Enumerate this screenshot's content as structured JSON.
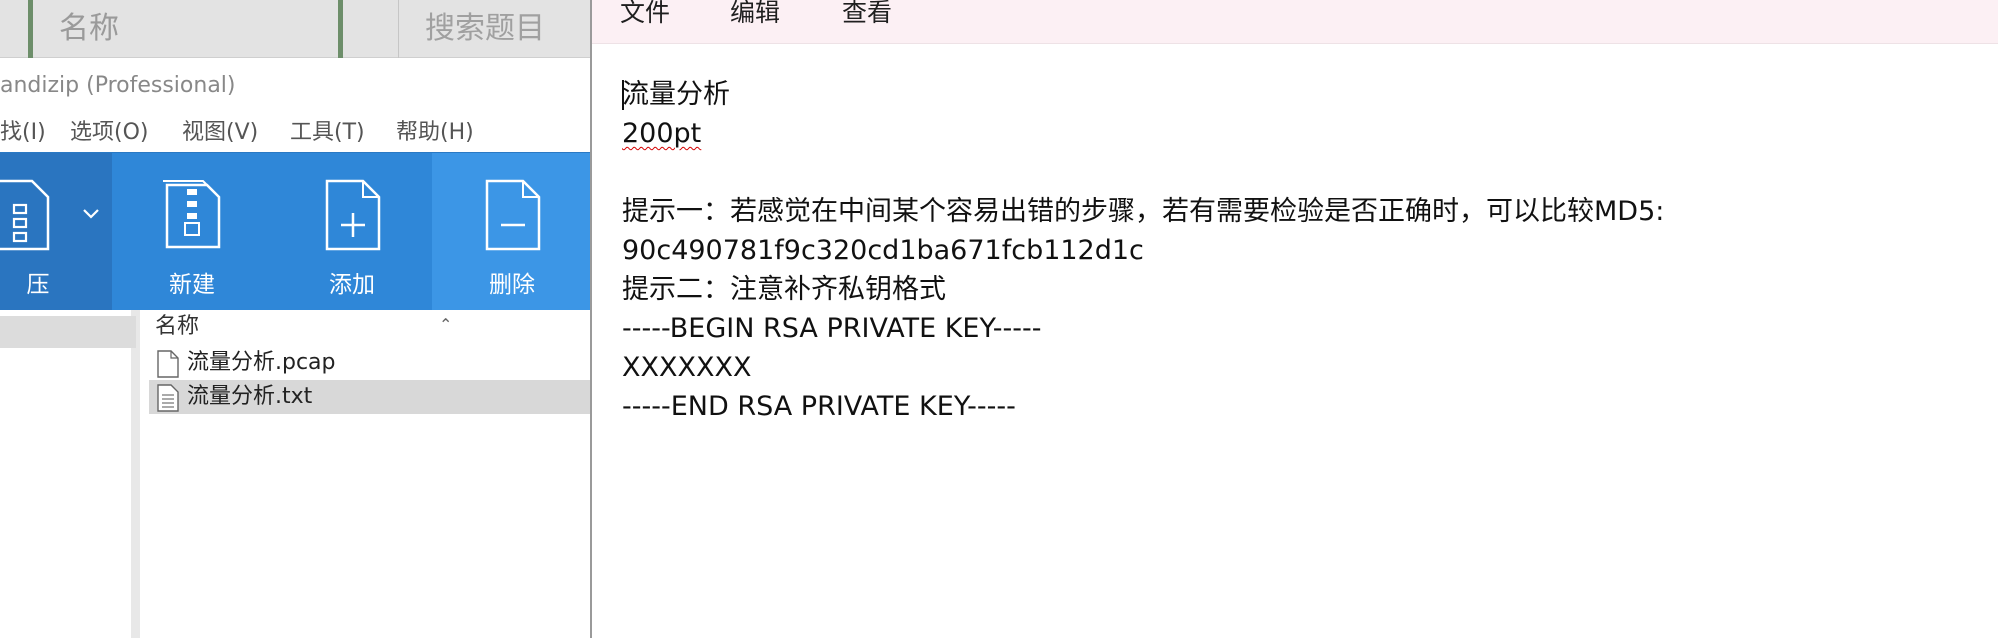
{
  "background_app": {
    "col1": "名称",
    "col3": "搜索题目"
  },
  "bandizip": {
    "title": "andizip (Professional)",
    "menu": [
      "找(I)",
      "选项(O)",
      "视图(V)",
      "工具(T)",
      "帮助(H)"
    ],
    "toolbar": {
      "extract_label": "压",
      "new_label": "新建",
      "add_label": "添加",
      "delete_label": "删除"
    },
    "list_header": "名称",
    "files": [
      {
        "name": "流量分析.pcap",
        "selected": false
      },
      {
        "name": "流量分析.txt",
        "selected": true
      }
    ]
  },
  "notepad": {
    "menu": [
      "文件",
      "编辑",
      "查看"
    ],
    "lines": [
      "流量分析",
      "200pt",
      "",
      "提示一：若感觉在中间某个容易出错的步骤，若有需要检验是否正确时，可以比较MD5:",
      "90c490781f9c320cd1ba671fcb112d1c",
      "提示二：注意补齐私钥格式",
      "-----BEGIN RSA PRIVATE KEY-----",
      "XXXXXXX",
      "-----END RSA PRIVATE KEY-----"
    ],
    "misspelled_word": "200pt"
  },
  "colors": {
    "toolbar_blue": "#2f87d8",
    "notepad_menu_bg": "#fcf0f4",
    "selection_gray": "#d8d8d8"
  }
}
